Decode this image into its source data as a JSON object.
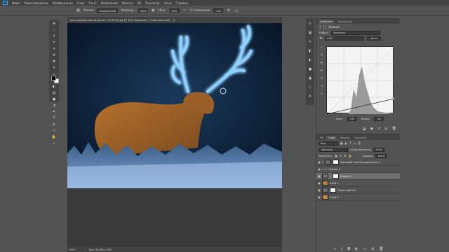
{
  "app": {
    "logo_text": "Ps",
    "accent": "#31a8ff"
  },
  "menu": [
    "Файл",
    "Редактирование",
    "Изображение",
    "Слои",
    "Текст",
    "Выделение",
    "Фильтр",
    "3D",
    "Просмотр",
    "Окно",
    "Справка"
  ],
  "options": {
    "mode_label": "Режим:",
    "mode_value": "Нормальный",
    "opacity_label": "Непрозр.:",
    "opacity_value": "100%",
    "flow_label": "Наж.:",
    "flow_value": "20%",
    "smoothing_label": "Сглаживание:",
    "smoothing_value": "10%"
  },
  "tools": [
    "move-tool",
    "marquee-tool",
    "lasso-tool",
    "quick-select-tool",
    "crop-tool",
    "eyedropper-tool",
    "healing-tool",
    "brush-tool",
    "stamp-tool",
    "history-brush-tool",
    "eraser-tool",
    "gradient-tool",
    "blur-tool",
    "dodge-tool",
    "pen-tool",
    "type-tool",
    "path-select-tool",
    "shape-tool",
    "hand-tool",
    "zoom-tool"
  ],
  "document": {
    "tab_title": "deer-spotted-animal-grass-1903045.jpg @ 50% (Кривые 1, Слой-маска/8)",
    "close": "×"
  },
  "status": {
    "zoom": "50%",
    "doc_size": "Док: 8,80М/1,00М"
  },
  "properties": {
    "tabs": [
      "Свойства",
      "Коррекция"
    ],
    "title": "Кривые",
    "preset_label": "Набор:",
    "preset_value": "Заказная",
    "channel_value": "RGB",
    "auto_label": "Авто",
    "input_label": "Вход:",
    "input_value": "255",
    "output_label": "Выход:",
    "output_value": "58"
  },
  "layers": {
    "tabs": [
      "3D",
      "Слои",
      "Каналы",
      "Контуры"
    ],
    "kind_value": "Вид",
    "blend_value": "Обычные",
    "opacity_label": "Непрозрачность:",
    "opacity_value": "100%",
    "lock_label": "Закрепить:",
    "fill_label": "Заливка:",
    "fill_value": "100%",
    "items": [
      {
        "name": "Цветовой тон/Насыщенность 2",
        "type": "adjustment",
        "selected": false
      },
      {
        "name": "Группа 1",
        "type": "group",
        "selected": false
      },
      {
        "name": "Кривые 1",
        "type": "adjustment",
        "selected": true
      },
      {
        "name": "Слой 1",
        "type": "pixel",
        "selected": false
      },
      {
        "name": "Поиск цвета 1",
        "type": "adjustment",
        "selected": false
      },
      {
        "name": "Слой 0",
        "type": "pixel",
        "selected": false
      }
    ]
  },
  "colors": {
    "foreground": "#000000",
    "background": "#ffffff",
    "glow": "#5fb6ff"
  }
}
